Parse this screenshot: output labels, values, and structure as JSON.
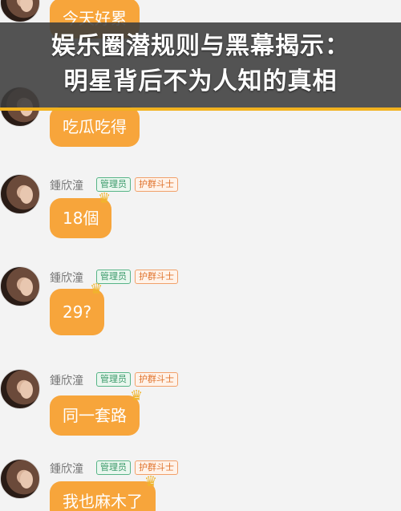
{
  "banner": {
    "line1": "娱乐圈潜规则与黑幕揭示：",
    "line2": "明星背后不为人知的真相"
  },
  "messages": [
    {
      "name": "",
      "admin_badge": "",
      "guard_badge": "",
      "text": "今天好累"
    },
    {
      "name": "",
      "admin_badge": "",
      "guard_badge": "",
      "text": "吃瓜吃得"
    },
    {
      "name": "鍾欣潼",
      "admin_badge": "管理员",
      "guard_badge": "护群斗士",
      "text": "18個"
    },
    {
      "name": "鍾欣潼",
      "admin_badge": "管理员",
      "guard_badge": "护群斗士",
      "text": "29?"
    },
    {
      "name": "鍾欣潼",
      "admin_badge": "管理员",
      "guard_badge": "护群斗士",
      "text": "同一套路"
    },
    {
      "name": "鍾欣潼",
      "admin_badge": "管理员",
      "guard_badge": "护群斗士",
      "text": "我也麻木了"
    }
  ],
  "colors": {
    "bubble": "#f7a53b",
    "banner_bg": "#3c3c3c",
    "banner_accent": "#f2b21f"
  },
  "icons": {
    "crown": "crown-icon",
    "avatar": "avatar-image"
  }
}
